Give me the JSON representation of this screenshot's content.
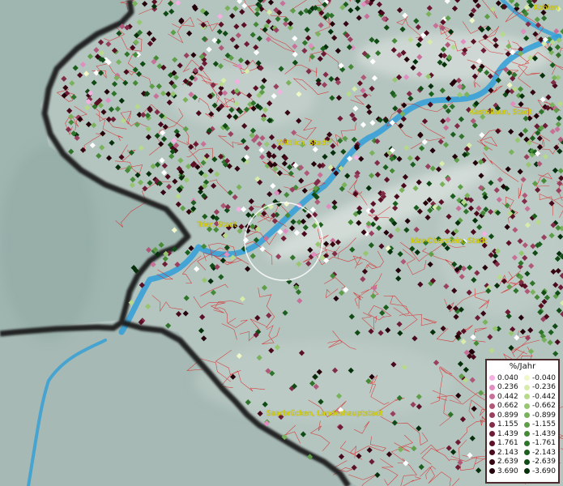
{
  "map": {
    "cities": [
      {
        "name": "Koblenz",
        "label": "Koblen"
      },
      {
        "name": "Kastellaun",
        "label": "Kastellaun, Stadt"
      },
      {
        "name": "Wittlich",
        "label": "Wittlich, Stadt"
      },
      {
        "name": "Trier",
        "label": "Trier, Stadt"
      },
      {
        "name": "Idar-Oberstein",
        "label": "Idar-Oberstein, Stadt"
      },
      {
        "name": "Saarbruecken",
        "label": "Saarbrücken, Landeshauptstadt"
      }
    ],
    "point_colors": {
      "pos": [
        "#f4b0e0",
        "#e08ec0",
        "#c87098",
        "#b05878",
        "#98405e",
        "#822c48",
        "#6e1c36",
        "#5c1026",
        "#4a0a1c",
        "#360612",
        "#24020a"
      ],
      "neg": [
        "#f0f7c8",
        "#d7ecaa",
        "#b7d98a",
        "#97c671",
        "#7ab25c",
        "#5e9e48",
        "#468a38",
        "#2f742a",
        "#1c5e1e",
        "#104a14",
        "#06300b"
      ],
      "zero": "#ffffff"
    }
  },
  "legend": {
    "title": "%/Jahr",
    "rows": [
      {
        "pos": "0.040",
        "neg": "-0.040",
        "pos_color": "#f4b0e0",
        "neg_color": "#f0f7c8"
      },
      {
        "pos": "0.236",
        "neg": "-0.236",
        "pos_color": "#e08ec0",
        "neg_color": "#d7ecaa"
      },
      {
        "pos": "0.442",
        "neg": "-0.442",
        "pos_color": "#c87098",
        "neg_color": "#b7d98a"
      },
      {
        "pos": "0.662",
        "neg": "-0.662",
        "pos_color": "#b05878",
        "neg_color": "#97c671"
      },
      {
        "pos": "0.899",
        "neg": "-0.899",
        "pos_color": "#98405e",
        "neg_color": "#7ab25c"
      },
      {
        "pos": "1.155",
        "neg": "-1.155",
        "pos_color": "#822c48",
        "neg_color": "#5e9e48"
      },
      {
        "pos": "1.439",
        "neg": "-1.439",
        "pos_color": "#6e1c36",
        "neg_color": "#468a38"
      },
      {
        "pos": "1.761",
        "neg": "-1.761",
        "pos_color": "#5c1026",
        "neg_color": "#2f742a"
      },
      {
        "pos": "2.143",
        "neg": "-2.143",
        "pos_color": "#4a0a1c",
        "neg_color": "#1c5e1e"
      },
      {
        "pos": "2.639",
        "neg": "-2.639",
        "pos_color": "#360612",
        "neg_color": "#104a14"
      },
      {
        "pos": "3.690",
        "neg": "-3.690",
        "pos_color": "#24020a",
        "neg_color": "#06300b"
      }
    ]
  },
  "colors": {
    "terrain": "#b9c6c2",
    "outside": "#9fb5b0",
    "border": "#1a1a1a",
    "district_lines": "#dd2222",
    "river": "#2f9fd8",
    "label": "#e8e000",
    "highlight_ring": "#ffffff"
  }
}
